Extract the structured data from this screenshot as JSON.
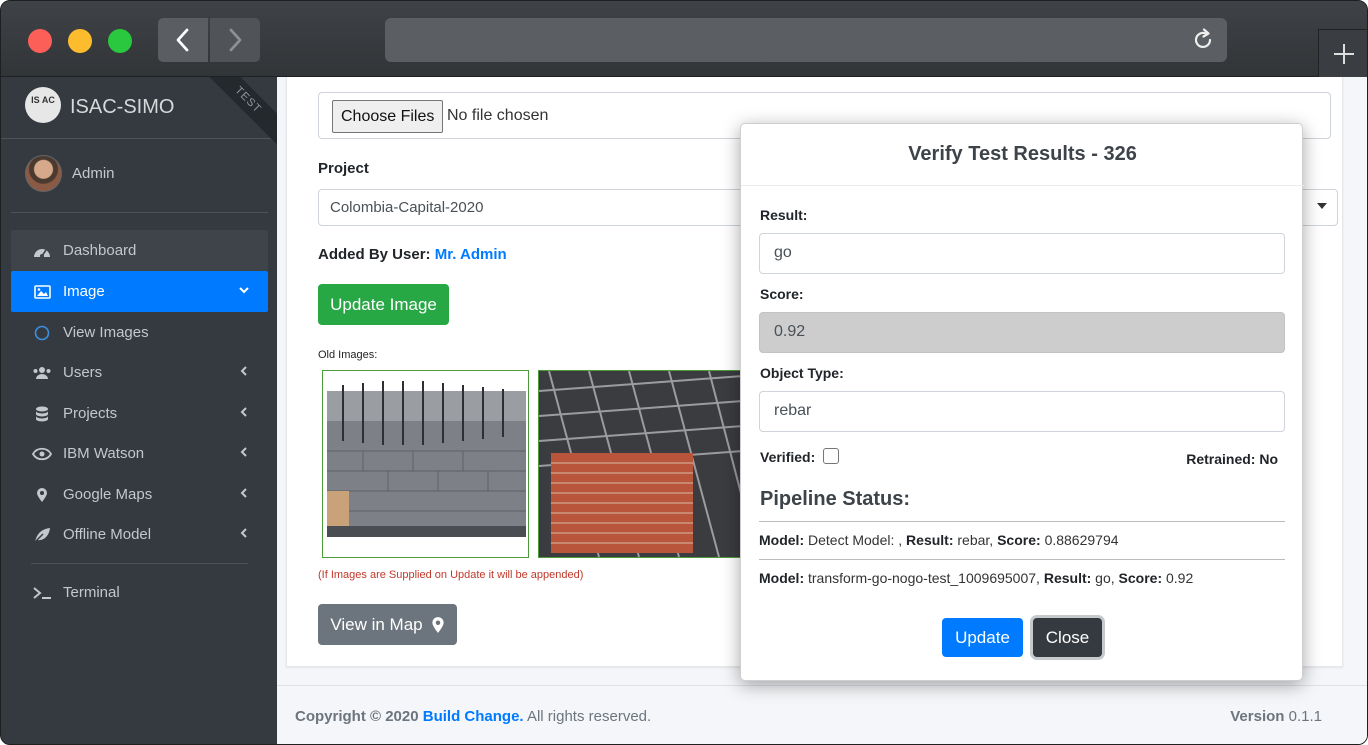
{
  "sidebar": {
    "brand_logo_text": "IS AC",
    "brand": "ISAC-SIMO",
    "ribbon": "TEST",
    "user": "Admin",
    "items": [
      {
        "label": "Dashboard",
        "icon": "dashboard-icon"
      },
      {
        "label": "Image",
        "icon": "image-icon"
      },
      {
        "label": "View Images",
        "icon": "circle-icon"
      },
      {
        "label": "Users",
        "icon": "users-icon"
      },
      {
        "label": "Projects",
        "icon": "database-icon"
      },
      {
        "label": "IBM Watson",
        "icon": "watson-icon"
      },
      {
        "label": "Google Maps",
        "icon": "map-marker-icon"
      },
      {
        "label": "Offline Model",
        "icon": "leaf-icon"
      },
      {
        "label": "Terminal",
        "icon": "terminal-icon"
      }
    ]
  },
  "form": {
    "file_button": "Choose Files",
    "file_status": "No file chosen",
    "project_label": "Project",
    "project_value": "Colombia-Capital-2020",
    "added_by_label": "Added By User:",
    "added_by_value": "Mr. Admin",
    "update_image_button": "Update Image",
    "old_images_label": "Old Images:",
    "append_note": "(If Images are Supplied on Update it will be appended)",
    "view_map_button": "View in Map"
  },
  "footer": {
    "copyright_prefix": "Copyright © 2020",
    "company": "Build Change.",
    "rights": "All rights reserved.",
    "version_label": "Version",
    "version_value": "0.1.1"
  },
  "modal": {
    "title": "Verify Test Results - 326",
    "result_label": "Result:",
    "result_value": "go",
    "score_label": "Score:",
    "score_value": "0.92",
    "object_type_label": "Object Type:",
    "object_type_value": "rebar",
    "verified_label": "Verified:",
    "retrained_label": "Retrained:",
    "retrained_value": "No",
    "pipeline_title": "Pipeline Status:",
    "pipeline": [
      {
        "model_label": "Model:",
        "model": "Detect Model: ,",
        "result_label": "Result:",
        "result": "rebar,",
        "score_label": "Score:",
        "score": "0.88629794"
      },
      {
        "model_label": "Model:",
        "model": "transform-go-nogo-test_1009695007,",
        "result_label": "Result:",
        "result": "go,",
        "score_label": "Score:",
        "score": "0.92"
      }
    ],
    "update_button": "Update",
    "close_button": "Close"
  }
}
